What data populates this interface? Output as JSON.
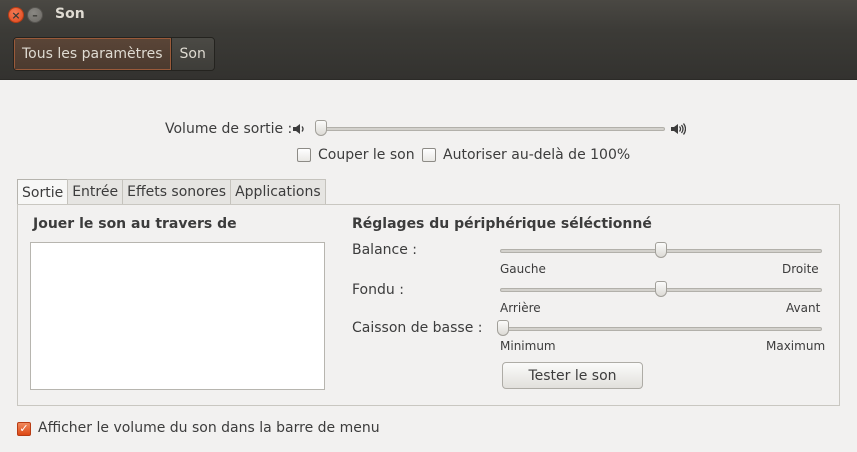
{
  "window": {
    "title": "Son"
  },
  "breadcrumb": {
    "all_settings": "Tous les paramètres",
    "current": "Son"
  },
  "output_volume": {
    "label": "Volume de sortie :",
    "level": 0.0
  },
  "options": {
    "mute": {
      "label": "Couper le son",
      "checked": false
    },
    "allow_above_100": {
      "label": "Autoriser au-delà de 100%",
      "checked": false
    }
  },
  "tabs": [
    "Sortie",
    "Entrée",
    "Effets sonores",
    "Applications"
  ],
  "active_tab": "Sortie",
  "output_panel": {
    "play_through_label": "Jouer le son au travers de",
    "devices": [],
    "settings_title": "Réglages du périphérique séléctionné",
    "balance": {
      "label": "Balance :",
      "left": "Gauche",
      "right": "Droite",
      "value": 0.5
    },
    "fade": {
      "label": "Fondu :",
      "left": "Arrière",
      "right": "Avant",
      "value": 0.5
    },
    "subwoofer": {
      "label": "Caisson de basse :",
      "left": "Minimum",
      "right": "Maximum",
      "value": 0.0
    },
    "test_button": "Tester le son"
  },
  "footer": {
    "show_volume_label": "Afficher le volume du son dans la barre de menu",
    "checked": true
  },
  "colors": {
    "accent": "#dd4814",
    "titlebar": "#3c3b37",
    "background": "#f2f1f0"
  }
}
